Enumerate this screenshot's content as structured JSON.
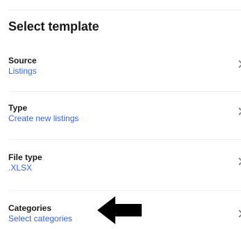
{
  "page": {
    "title": "Select template"
  },
  "fields": [
    {
      "label": "Source",
      "value": "Listings"
    },
    {
      "label": "Type",
      "value": "Create new listings"
    },
    {
      "label": "File type",
      "value": ".XLSX"
    },
    {
      "label": "Categories",
      "value": "Select categories"
    }
  ],
  "icons": {
    "row_chevron": "chevron-right-icon",
    "annotation": "arrow-left-icon"
  },
  "colors": {
    "title_text": "#191919",
    "link_text": "#3665f3",
    "annotation_arrow": "#000000"
  }
}
